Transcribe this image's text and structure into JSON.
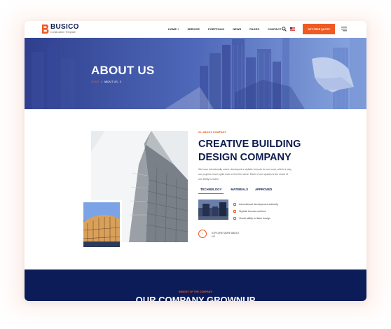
{
  "brand": {
    "name": "BUSICO",
    "tagline": "Construction Template",
    "accent": "#f05a22",
    "navy": "#0e1c4d"
  },
  "nav": {
    "items": [
      "HOME +",
      "SERVICE",
      "PORTFOLIO",
      "NEWS",
      "PAGES",
      "CONTACT"
    ],
    "cta_label": "GET FREE QUOTE",
    "icons": [
      "search-icon",
      "flag-icon",
      "hamburger-menu-icon"
    ]
  },
  "banner": {
    "title": "ABOUT US",
    "breadcrumb_home": "HOME",
    "breadcrumb_sep": "/",
    "breadcrumb_current": "ABOUT US - 3"
  },
  "about": {
    "tagline": "01. ABOUT COMPANY",
    "headline": "CREATIVE BUILDING DESIGN COMPANY",
    "description": "We have intentionally solver developed a stylistic formula for our work, which is why our projects never quite look or feel the same. Each of our spaces is the result of our ability to listen",
    "tabs": [
      "TECHNOLOGY",
      "MATERIALS",
      "APPROVED"
    ],
    "features": [
      "International development authority",
      "Stylistic formula method",
      "Visual ability to listen design"
    ],
    "explore_label": "EXPLORE MORE ABOUT US"
  },
  "growth": {
    "subtitle": "INSIGHT OF THE COMPANY",
    "title": "OUR COMPANY GROWNUP"
  }
}
